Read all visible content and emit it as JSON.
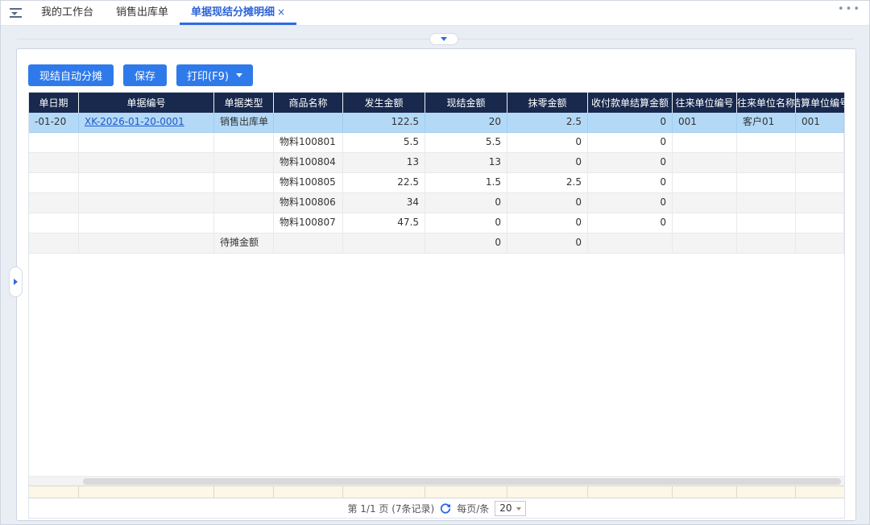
{
  "tabbar": {
    "tabs": [
      {
        "label": "我的工作台"
      },
      {
        "label": "销售出库单"
      },
      {
        "label": "单据现结分摊明细",
        "close": "×"
      }
    ],
    "more_options": "•••"
  },
  "toolbar": {
    "auto_allocate_label": "现结自动分摊",
    "save_label": "保存",
    "print_label": "打印(F9)"
  },
  "grid": {
    "columns": [
      "单日期",
      "单据编号",
      "单据类型",
      "商品名称",
      "发生金额",
      "现结金额",
      "抹零金额",
      "收付款单结算金额",
      "往来单位编号",
      "往来单位名称",
      "结算单位编号"
    ],
    "rows": [
      {
        "cells": [
          "-01-20",
          "XK-2026-01-20-0001",
          "销售出库单",
          "",
          "122.5",
          "20",
          "2.5",
          "0",
          "001",
          "客户01",
          "001"
        ],
        "selected": true,
        "link_col": 1
      },
      {
        "cells": [
          "",
          "",
          "",
          "物料100801",
          "5.5",
          "5.5",
          "0",
          "0",
          "",
          "",
          ""
        ]
      },
      {
        "cells": [
          "",
          "",
          "",
          "物料100804",
          "13",
          "13",
          "0",
          "0",
          "",
          "",
          ""
        ]
      },
      {
        "cells": [
          "",
          "",
          "",
          "物料100805",
          "22.5",
          "1.5",
          "2.5",
          "0",
          "",
          "",
          ""
        ]
      },
      {
        "cells": [
          "",
          "",
          "",
          "物料100806",
          "34",
          "0",
          "0",
          "0",
          "",
          "",
          ""
        ]
      },
      {
        "cells": [
          "",
          "",
          "",
          "物料100807",
          "47.5",
          "0",
          "0",
          "0",
          "",
          "",
          ""
        ]
      },
      {
        "cells": [
          "",
          "",
          "待摊金额",
          "",
          "",
          "0",
          "0",
          "",
          "",
          "",
          ""
        ]
      }
    ]
  },
  "pager": {
    "page_info": "第 1/1 页 (7条记录)",
    "per_page_label": "每页/条",
    "page_size": "20"
  },
  "colors": {
    "header_bg": "#18294d",
    "selected_row": "#b3d9f7",
    "button_blue": "#2f7aeb",
    "link_blue": "#1f58c8",
    "active_tab": "#2a62d9",
    "summary_row": "#fcf7e6"
  }
}
